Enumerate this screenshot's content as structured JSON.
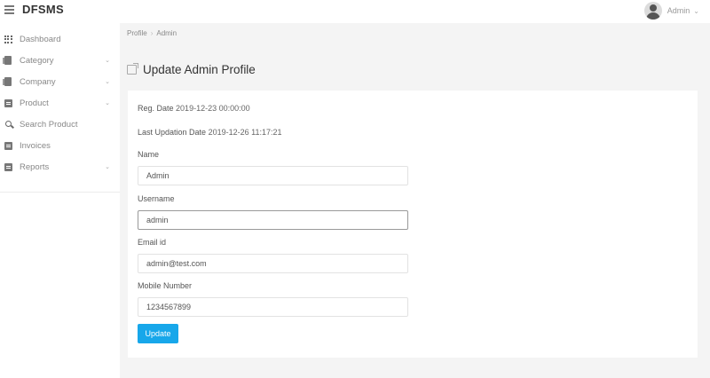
{
  "app": {
    "brand": "DFSMS"
  },
  "header": {
    "user_name": "Admin",
    "avatar_icon": "user-avatar-icon",
    "menu_icon": "hamburger-icon"
  },
  "sidebar": {
    "items": [
      {
        "label": "Dashboard",
        "icon": "grid-icon",
        "has_submenu": false
      },
      {
        "label": "Category",
        "icon": "files-icon",
        "has_submenu": true
      },
      {
        "label": "Company",
        "icon": "files-icon",
        "has_submenu": true
      },
      {
        "label": "Product",
        "icon": "list-icon",
        "has_submenu": true
      },
      {
        "label": "Search Product",
        "icon": "search-icon",
        "has_submenu": false
      },
      {
        "label": "Invoices",
        "icon": "list-icon",
        "has_submenu": false
      },
      {
        "label": "Reports",
        "icon": "report-icon",
        "has_submenu": true
      }
    ]
  },
  "breadcrumb": {
    "items": [
      "Profile",
      "Admin"
    ],
    "separator": "›"
  },
  "page": {
    "title": "Update Admin Profile"
  },
  "profile": {
    "reg_date_label": "Reg. Date",
    "reg_date_value": "2019-12-23 00:00:00",
    "last_update_label": "Last Updation Date",
    "last_update_value": "2019-12-26 11:17:21",
    "fields": [
      {
        "label": "Name",
        "value": "Admin"
      },
      {
        "label": "Username",
        "value": "admin"
      },
      {
        "label": "Email id",
        "value": "admin@test.com"
      },
      {
        "label": "Mobile Number",
        "value": "1234567899"
      }
    ],
    "submit_label": "Update"
  },
  "colors": {
    "accent": "#17a7ea",
    "background": "#f4f4f4",
    "card": "#ffffff"
  }
}
